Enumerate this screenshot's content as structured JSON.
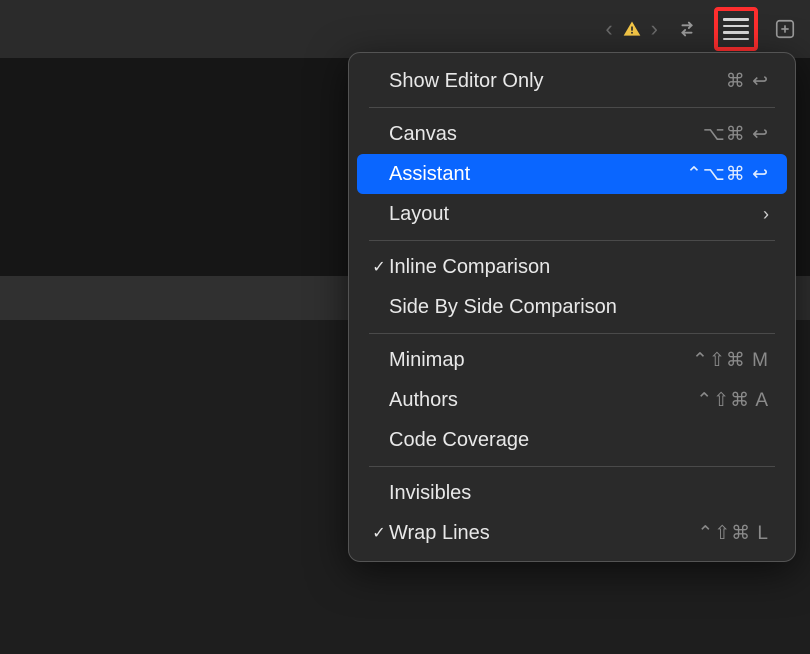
{
  "toolbar": {
    "warning_icon": "warning",
    "swap_icon": "swap",
    "lines_icon": "adjust-editor-options",
    "plus_icon": "add-editor"
  },
  "menu": {
    "sections": [
      [
        {
          "label": "Show Editor Only",
          "shortcut": "⌘ ↩",
          "checked": false,
          "submenu": false,
          "selected": false
        }
      ],
      [
        {
          "label": "Canvas",
          "shortcut": "⌥⌘ ↩",
          "checked": false,
          "submenu": false,
          "selected": false
        },
        {
          "label": "Assistant",
          "shortcut": "⌃⌥⌘ ↩",
          "checked": false,
          "submenu": false,
          "selected": true
        },
        {
          "label": "Layout",
          "shortcut": "",
          "checked": false,
          "submenu": true,
          "selected": false
        }
      ],
      [
        {
          "label": "Inline Comparison",
          "shortcut": "",
          "checked": true,
          "submenu": false,
          "selected": false
        },
        {
          "label": "Side By Side Comparison",
          "shortcut": "",
          "checked": false,
          "submenu": false,
          "selected": false
        }
      ],
      [
        {
          "label": "Minimap",
          "shortcut": "⌃⇧⌘ M",
          "checked": false,
          "submenu": false,
          "selected": false
        },
        {
          "label": "Authors",
          "shortcut": "⌃⇧⌘ A",
          "checked": false,
          "submenu": false,
          "selected": false
        },
        {
          "label": "Code Coverage",
          "shortcut": "",
          "checked": false,
          "submenu": false,
          "selected": false
        }
      ],
      [
        {
          "label": "Invisibles",
          "shortcut": "",
          "checked": false,
          "submenu": false,
          "selected": false
        },
        {
          "label": "Wrap Lines",
          "shortcut": "⌃⇧⌘ L",
          "checked": true,
          "submenu": false,
          "selected": false
        }
      ]
    ]
  }
}
